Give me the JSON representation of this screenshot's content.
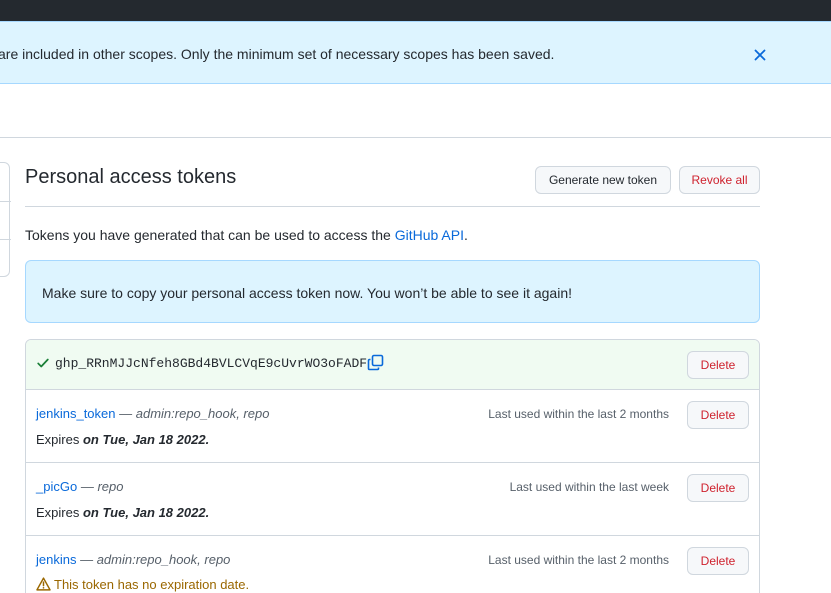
{
  "flash": {
    "message": "are included in other scopes. Only the minimum set of necessary scopes has been saved.",
    "close_icon": "close-icon"
  },
  "page": {
    "title": "Personal access tokens",
    "generate_label": "Generate new token",
    "revoke_label": "Revoke all",
    "intro_before": "Tokens you have generated that can be used to access the ",
    "intro_link": "GitHub API",
    "intro_after": ".",
    "notice": "Make sure to copy your personal access token now. You won’t be able to see it again!"
  },
  "new_token": {
    "value": "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",
    "delete_label": "Delete",
    "icons": [
      "check-icon",
      "copy-icon"
    ]
  },
  "tokens": [
    {
      "name": "jenkins_token",
      "separator": " — ",
      "scopes": "admin:repo_hook, repo",
      "last_used": "Last used within the last 2 months",
      "expires_prefix": "Expires ",
      "expires_date": "on Tue, Jan 18 2022.",
      "delete_label": "Delete"
    },
    {
      "name": "_picGo",
      "separator": " — ",
      "scopes": "repo",
      "last_used": "Last used within the last week",
      "expires_prefix": "Expires ",
      "expires_date": "on Tue, Jan 18 2022.",
      "delete_label": "Delete"
    },
    {
      "name": "jenkins",
      "separator": " — ",
      "scopes": "admin:repo_hook, repo",
      "last_used": "Last used within the last 2 months",
      "warning": "This token has no expiration date.",
      "delete_label": "Delete"
    }
  ],
  "colors": {
    "accent": "#0969da",
    "danger": "#cf222e",
    "success": "#1a7f37",
    "warning": "#9a6700",
    "info_bg": "#ddf4ff",
    "success_bg": "#f0fbf2"
  }
}
